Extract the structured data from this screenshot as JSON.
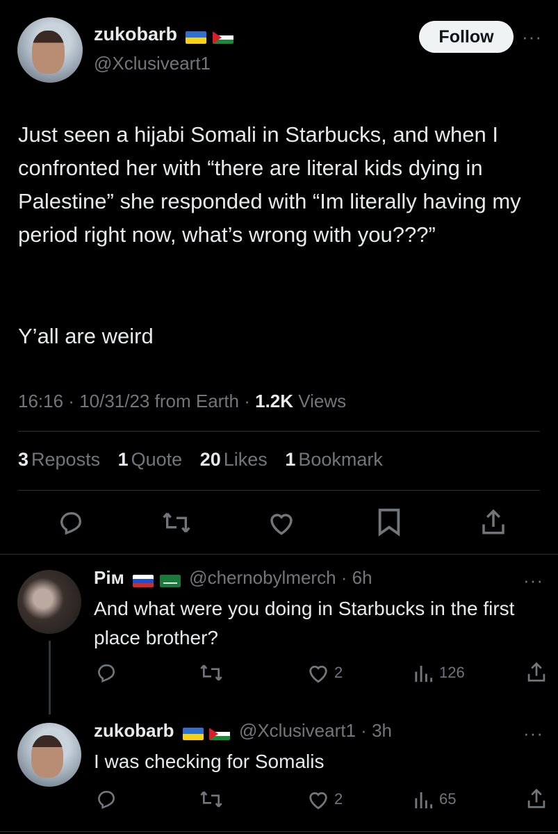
{
  "tweet": {
    "author_name": "zukobarb",
    "author_handle": "@Xclusiveart1",
    "follow_label": "Follow",
    "more_label": "···",
    "text_p1": "Just seen a hijabi Somali in Starbucks, and when I confronted her with “there are literal kids dying in Palestine” she responded with “Im literally having my period right now, what’s wrong with you???”",
    "text_p2": "Y’all are weird",
    "time": "16:16",
    "date": "10/31/23",
    "source": "from Earth",
    "views_count": "1.2K",
    "views_label": "Views",
    "sep": " · "
  },
  "stats": {
    "reposts_count": "3",
    "reposts_label": "Reposts",
    "quotes_count": "1",
    "quotes_label": "Quote",
    "likes_count": "20",
    "likes_label": "Likes",
    "bookmarks_count": "1",
    "bookmarks_label": "Bookmark"
  },
  "replies": [
    {
      "name": "Рім",
      "handle": "@chernobylmerch",
      "age": "6h",
      "text": "And what were you doing in Starbucks in the first place brother?",
      "likes": "2",
      "views": "126",
      "more_label": "···"
    },
    {
      "name": "zukobarb",
      "handle": "@Xclusiveart1",
      "age": "3h",
      "text": "I was checking for Somalis",
      "likes": "2",
      "views": "65",
      "more_label": "···"
    }
  ],
  "icons": {
    "flags_author": [
      "ukraine-flag-icon",
      "palestine-flag-icon"
    ],
    "flags_rim": [
      "russia-flag-icon",
      "saudi-flag-icon"
    ]
  },
  "colors": {
    "background": "#000000",
    "text": "#e7e9ea",
    "muted": "#71767b",
    "divider": "#2f3336",
    "button": "#eff3f4"
  }
}
